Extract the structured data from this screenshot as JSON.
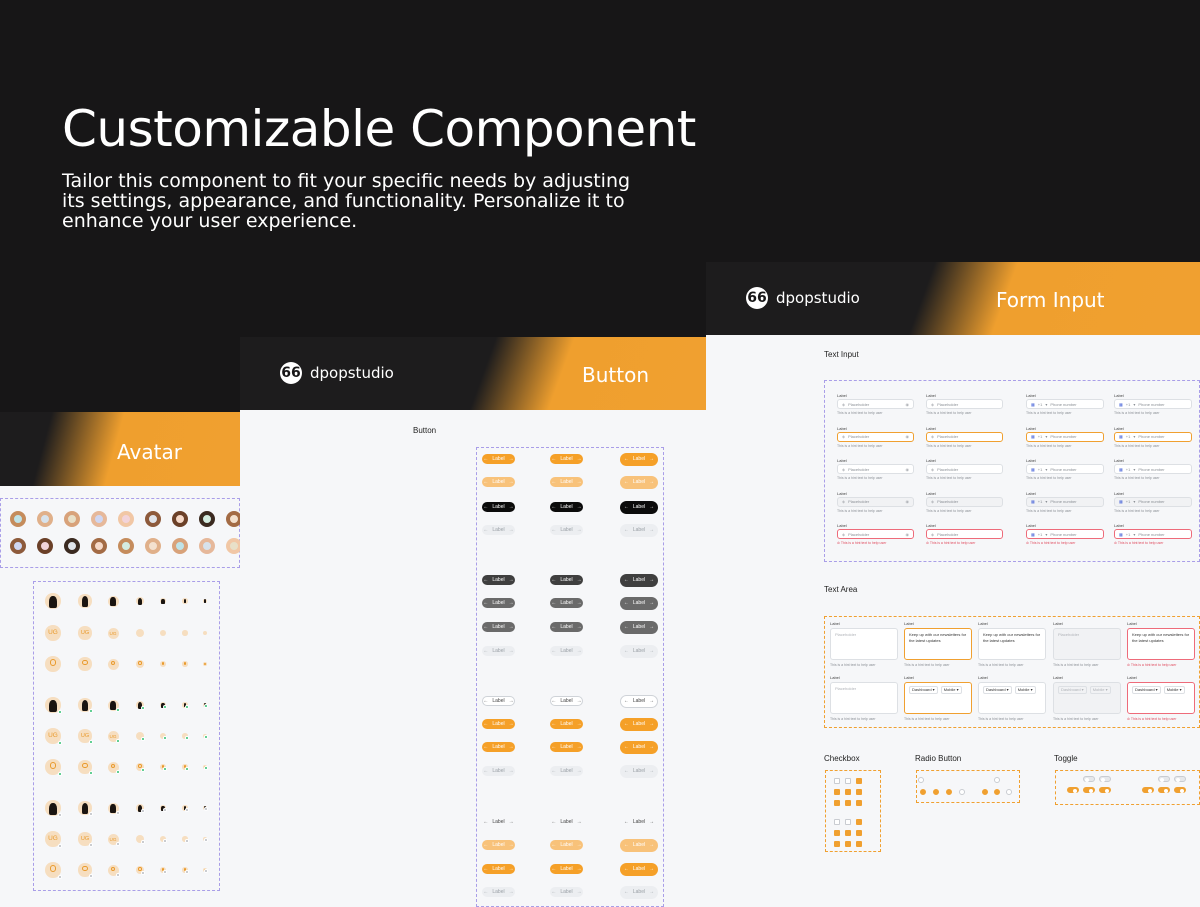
{
  "hero": {
    "title": "Customizable Component",
    "subtitle": "Tailor this component to fit your specific needs by adjusting its settings, appearance, and functionality. Personalize it to enhance your user experience."
  },
  "brand": {
    "logo_glyph": "66",
    "name": "dpopstudio"
  },
  "cards": {
    "avatar": {
      "title": "Avatar"
    },
    "button": {
      "title": "Button",
      "section": "Button"
    },
    "form": {
      "title": "Form Input"
    }
  },
  "avatar": {
    "initials": "UG",
    "user_icon": "user-icon"
  },
  "button": {
    "label": "Label",
    "arrow_left": "←",
    "arrow_right": "→"
  },
  "form": {
    "sections": {
      "text_input": "Text Input",
      "text_area": "Text Area",
      "checkbox": "Checkbox",
      "radio": "Radio Button",
      "toggle": "Toggle"
    },
    "field_label": "Label",
    "placeholder": "Placeholder",
    "phone_placeholder": "Phone number",
    "country_code": "+1",
    "help_text": "This is a hint text to help user",
    "error_text": "This is a hint text to help user",
    "textarea_value": "Keep up with our newsletters for the latest updates",
    "select_values": [
      "Dashboard",
      "Mobile"
    ]
  },
  "colors": {
    "accent": "#f0a030",
    "dark": "#171617",
    "error": "#ee6b7a"
  }
}
